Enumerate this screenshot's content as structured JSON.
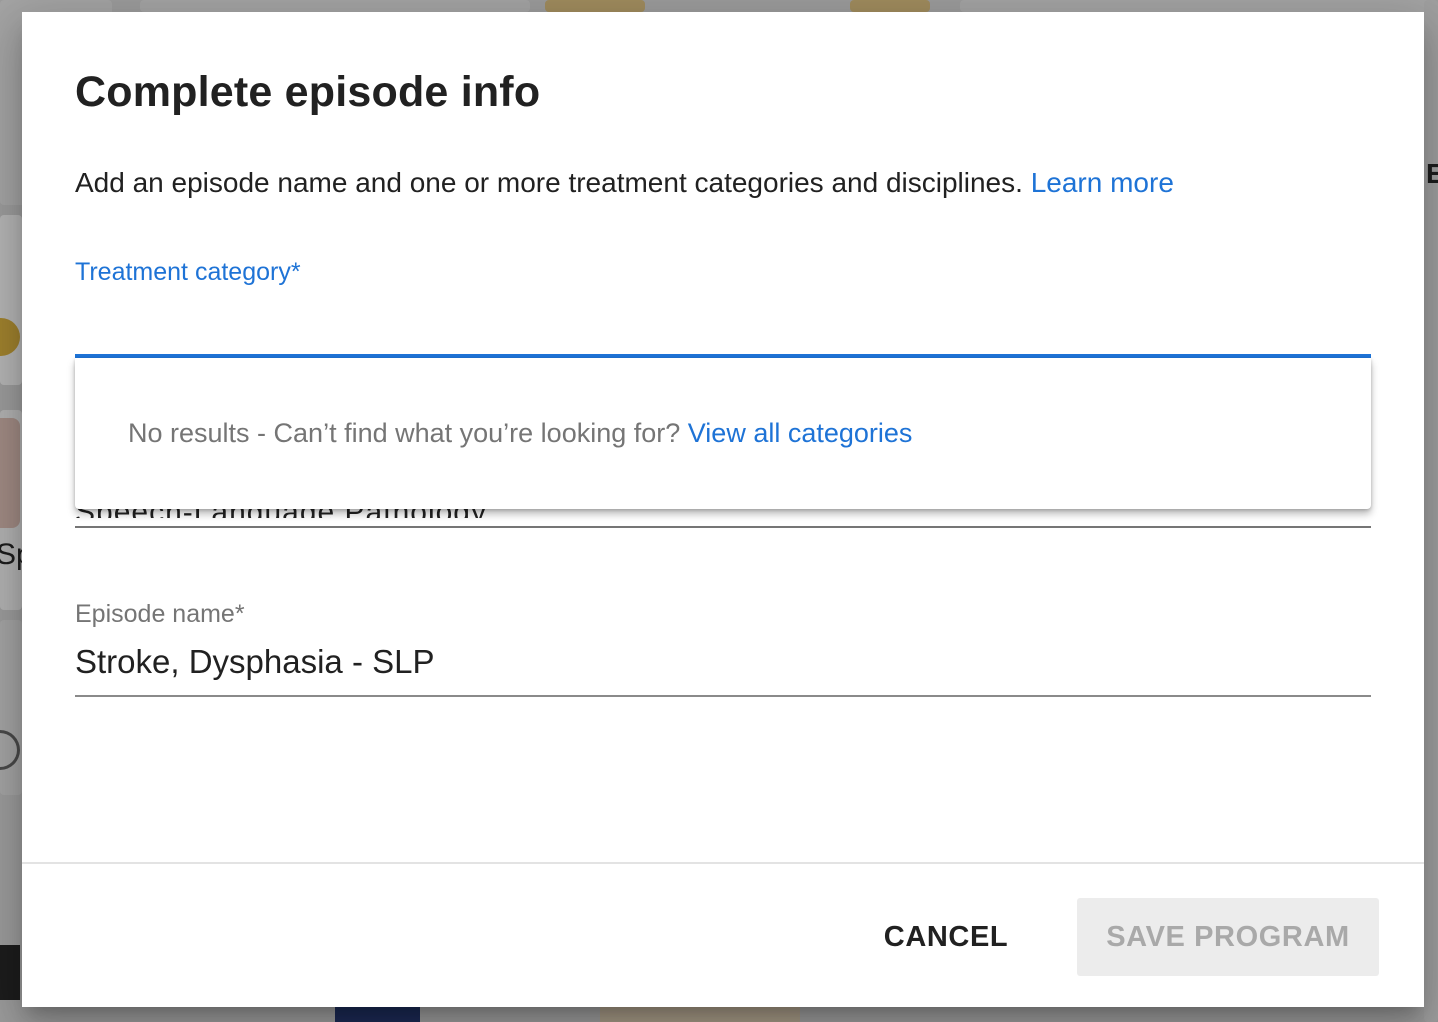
{
  "dialog": {
    "title": "Complete episode info",
    "description": "Add an episode name and one or more treatment categories and disciplines.",
    "learn_more": "Learn more"
  },
  "treatment_category": {
    "label": "Treatment category*",
    "value": "",
    "dropdown": {
      "message": "No results - Can’t find what you’re looking for?",
      "link": "View all categories"
    }
  },
  "discipline": {
    "value": "Speech-Language Pathology"
  },
  "episode_name": {
    "label": "Episode name*",
    "value": "Stroke, Dysphasia - SLP"
  },
  "actions": {
    "cancel": "CANCEL",
    "save": "SAVE PROGRAM"
  },
  "background": {
    "text_fragment_1": "Sp",
    "text_fragment_2": "E"
  },
  "colors": {
    "accent": "#1e73d6",
    "overlay": "#9c9c9c",
    "disabled_button_bg": "#ececec",
    "disabled_button_text": "#a9a9a9"
  }
}
